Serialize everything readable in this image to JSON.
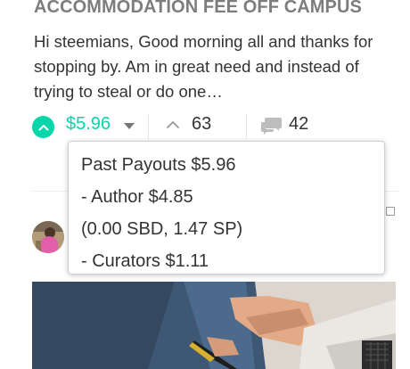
{
  "post": {
    "title": "ACCOMMODATION FEE OFF CAMPUS",
    "excerpt": "Hi steemians, Good morning all and thanks for stopping by. Am in great need and instead of trying to steal or do one…"
  },
  "footer": {
    "payout": "$5.96",
    "votes": "63",
    "comments": "42"
  },
  "payout_tooltip": {
    "line1": "Past Payouts $5.96",
    "line2": "- Author $4.85",
    "line3": "(0.00 SBD, 1.47 SP)",
    "line4": "- Curators $1.11"
  },
  "icons": {
    "vote": "chevron-up-circle-icon",
    "dropdown": "caret-down-icon",
    "upvotes": "chevron-up-icon",
    "comments": "comment-bubbles-icon"
  },
  "colors": {
    "accent": "#06d6a9",
    "title": "#7d7d7d",
    "text": "#333333"
  }
}
